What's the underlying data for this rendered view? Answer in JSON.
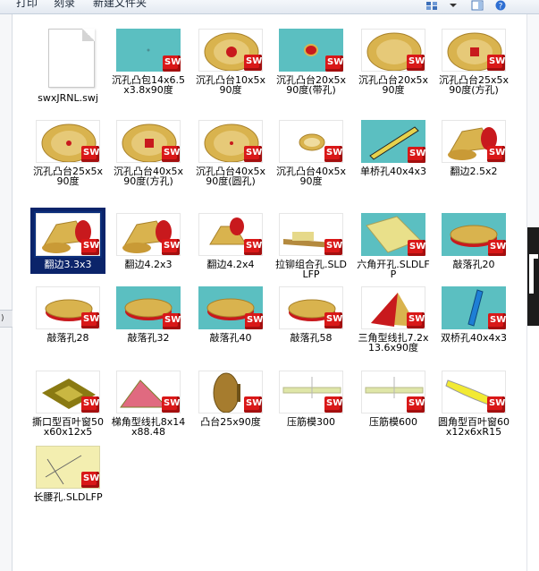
{
  "toolbar": {
    "print_label": "打印",
    "burn_label": "刻录",
    "new_folder_label": "新建文件夹"
  },
  "colors": {
    "selection": "#0b246a",
    "teal_bg": "#5bbfc1",
    "gold": "#d9b34e",
    "red": "#c8191d"
  },
  "files": [
    {
      "name": "swxJRNL.swj",
      "kind": "document"
    },
    {
      "name": "沉孔凸包14x6.5x3.8x90度",
      "kind": "sw",
      "bg": "teal"
    },
    {
      "name": "沉孔凸台10x5x90度",
      "kind": "sw",
      "bg": "white"
    },
    {
      "name": "沉孔凸台20x5x90度(带孔)",
      "kind": "sw",
      "bg": "teal"
    },
    {
      "name": "沉孔凸台20x5x90度",
      "kind": "sw",
      "bg": "white"
    },
    {
      "name": "沉孔凸台25x5x90度(方孔)",
      "kind": "sw",
      "bg": "white"
    },
    {
      "name": "沉孔凸台25x5x90度",
      "kind": "sw",
      "bg": "white"
    },
    {
      "name": "沉孔凸台40x5x90度(方孔)",
      "kind": "sw",
      "bg": "white"
    },
    {
      "name": "沉孔凸台40x5x90度(圆孔)",
      "kind": "sw",
      "bg": "white"
    },
    {
      "name": "沉孔凸台40x5x90度",
      "kind": "sw",
      "bg": "white"
    },
    {
      "name": "单桥孔40x4x3",
      "kind": "sw",
      "bg": "teal"
    },
    {
      "name": "翻边2.5x2",
      "kind": "sw",
      "bg": "white"
    },
    {
      "name": "翻边3.3x3",
      "kind": "sw",
      "bg": "white",
      "selected": true
    },
    {
      "name": "翻边4.2x3",
      "kind": "sw",
      "bg": "white"
    },
    {
      "name": "翻边4.2x4",
      "kind": "sw",
      "bg": "white"
    },
    {
      "name": "拉铆组合孔.SLDLFP",
      "kind": "sw",
      "bg": "white"
    },
    {
      "name": "六角开孔.SLDLFP",
      "kind": "sw",
      "bg": "teal"
    },
    {
      "name": "敲落孔20",
      "kind": "sw",
      "bg": "teal"
    },
    {
      "name": "敲落孔28",
      "kind": "sw",
      "bg": "white"
    },
    {
      "name": "敲落孔32",
      "kind": "sw",
      "bg": "teal"
    },
    {
      "name": "敲落孔40",
      "kind": "sw",
      "bg": "teal"
    },
    {
      "name": "敲落孔58",
      "kind": "sw",
      "bg": "white"
    },
    {
      "name": "三角型线扎7.2x13.6x90度",
      "kind": "sw",
      "bg": "white"
    },
    {
      "name": "双桥孔40x4x3",
      "kind": "sw",
      "bg": "teal"
    },
    {
      "name": "撕口型百叶窗50x60x12x5",
      "kind": "sw",
      "bg": "white"
    },
    {
      "name": "梯角型线扎8x14x88.48",
      "kind": "sw",
      "bg": "white"
    },
    {
      "name": "凸台25x90度",
      "kind": "sw",
      "bg": "white"
    },
    {
      "name": "压筋模300",
      "kind": "sw",
      "bg": "white"
    },
    {
      "name": "压筋模600",
      "kind": "sw",
      "bg": "white"
    },
    {
      "name": "圆角型百叶窗60x12x6xR15",
      "kind": "sw",
      "bg": "white"
    },
    {
      "name": "长腰孔.SLDLFP",
      "kind": "sw",
      "bg": "yellow"
    }
  ]
}
